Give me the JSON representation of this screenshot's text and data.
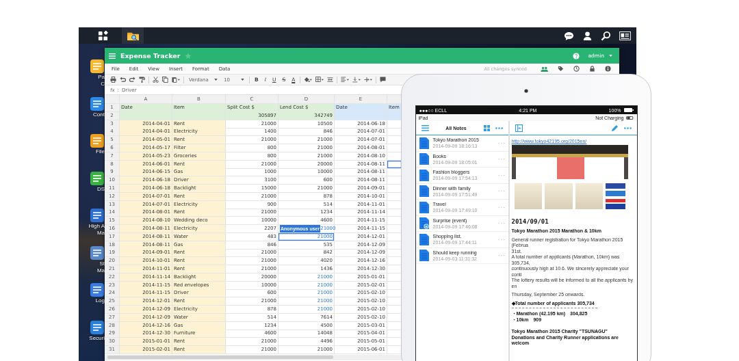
{
  "desktop_icons": [
    {
      "lines": [
        "Pa",
        "C"
      ]
    },
    {
      "lines": [
        "Cont"
      ]
    },
    {
      "lines": [
        "File"
      ]
    },
    {
      "lines": [
        "DS"
      ]
    },
    {
      "lines": [
        "High A",
        "Ma"
      ]
    },
    {
      "lines": [
        "St",
        "Ma"
      ]
    },
    {
      "lines": [
        "Log"
      ]
    },
    {
      "lines": [
        "Securi"
      ]
    }
  ],
  "spreadsheet": {
    "title": "Expense Tracker",
    "starred": false,
    "user": "admin",
    "sync_status": "All changes synced",
    "menu": [
      "File",
      "Edit",
      "View",
      "Insert",
      "Format",
      "Data"
    ],
    "font": "Verdana",
    "font_size": "10",
    "format_buttons": [
      {
        "kind": "bold",
        "label": "B"
      },
      {
        "kind": "italic",
        "label": "I"
      },
      {
        "kind": "underline",
        "label": "U"
      },
      {
        "kind": "strike",
        "label": "S"
      },
      {
        "kind": "color",
        "label": "A"
      }
    ],
    "formula": {
      "label": "fx",
      "separator": ":",
      "value": "Driver"
    },
    "columns": [
      "A",
      "B",
      "C",
      "D",
      "E"
    ],
    "header_row": {
      "n": "1",
      "cells": [
        "Date",
        "Item",
        "Split Cost $",
        "Lend Cost $",
        "Date",
        "Item"
      ]
    },
    "total_row": {
      "n": "2",
      "c": "305897",
      "d": "342749"
    },
    "rows": [
      {
        "n": "3",
        "a": "2014-04-01",
        "b": "Rent",
        "c": "21000",
        "d": "10500",
        "e": "2014-06-18",
        "d_edited": false,
        "d_selected": false,
        "f_selected": false
      },
      {
        "n": "4",
        "a": "2014-04-01",
        "b": "Electricity",
        "c": "1400",
        "d": "846",
        "e": "2014-07-01",
        "d_edited": false,
        "d_selected": false,
        "f_selected": false
      },
      {
        "n": "5",
        "a": "2014-05-01",
        "b": "Rent",
        "c": "21000",
        "d": "21000",
        "e": "2014-07-01",
        "d_edited": false,
        "d_selected": false,
        "f_selected": false
      },
      {
        "n": "6",
        "a": "2014-05-17",
        "b": "Filter",
        "c": "800",
        "d": "21000",
        "e": "2014-08-01",
        "d_edited": false,
        "d_selected": false,
        "f_selected": false
      },
      {
        "n": "7",
        "a": "2014-05-23",
        "b": "Groceries",
        "c": "800",
        "d": "21000",
        "e": "2014-08-10",
        "d_edited": false,
        "d_selected": false,
        "f_selected": false
      },
      {
        "n": "8",
        "a": "2014-06-01",
        "b": "Rent",
        "c": "21000",
        "d": "20000",
        "e": "2014-08-11",
        "d_edited": false,
        "d_selected": false,
        "f_selected": true
      },
      {
        "n": "9",
        "a": "2014-06-15",
        "b": "Gas",
        "c": "1000",
        "d": "10000",
        "e": "2014-08-11",
        "d_edited": false,
        "d_selected": false,
        "f_selected": false
      },
      {
        "n": "10",
        "a": "2014-06-18",
        "b": "Driver",
        "c": "3100",
        "d": "600",
        "e": "2014-08-11",
        "d_edited": false,
        "d_selected": false,
        "f_selected": false
      },
      {
        "n": "11",
        "a": "2014-06-18",
        "b": "Backlight",
        "c": "15000",
        "d": "21000",
        "e": "2014-09-01",
        "d_edited": false,
        "d_selected": false,
        "f_selected": false
      },
      {
        "n": "12",
        "a": "2014-07-01",
        "b": "Rent",
        "c": "21000",
        "d": "878",
        "e": "2014-10-01",
        "d_edited": false,
        "d_selected": false,
        "f_selected": false
      },
      {
        "n": "13",
        "a": "2014-07-01",
        "b": "Electricity",
        "c": "900",
        "d": "514",
        "e": "2014-11-01",
        "d_edited": false,
        "d_selected": false,
        "f_selected": false
      },
      {
        "n": "14",
        "a": "2014-08-01",
        "b": "Rent",
        "c": "21000",
        "d": "1234",
        "e": "2014-11-14",
        "d_edited": false,
        "d_selected": false,
        "f_selected": false
      },
      {
        "n": "15",
        "a": "2014-08-10",
        "b": "Wedding deco",
        "c": "10000",
        "d": "4600",
        "e": "2014-11-15",
        "d_edited": false,
        "d_selected": false,
        "f_selected": false
      },
      {
        "n": "16",
        "a": "2014-08-11",
        "b": "Electricity",
        "c": "2207",
        "d": "21000",
        "e": "2014-11-15",
        "d_edited": true,
        "d_selected": false,
        "f_selected": false,
        "d_user": "Anonymous user"
      },
      {
        "n": "17",
        "a": "2014-08-11",
        "b": "Water",
        "c": "483",
        "d": "21000",
        "e": "2014-12-01",
        "d_edited": true,
        "d_selected": true,
        "f_selected": false
      },
      {
        "n": "18",
        "a": "2014-08-11",
        "b": "Gas",
        "c": "846",
        "d": "535",
        "e": "2014-12-09",
        "d_edited": false,
        "d_selected": false,
        "f_selected": false
      },
      {
        "n": "19",
        "a": "2014-09-01",
        "b": "Rent",
        "c": "21000",
        "d": "842",
        "e": "2014-12-09",
        "d_edited": false,
        "d_selected": false,
        "f_selected": false
      },
      {
        "n": "20",
        "a": "2014-10-01",
        "b": "Rent",
        "c": "21000",
        "d": "4020",
        "e": "2014-12-16",
        "d_edited": false,
        "d_selected": false,
        "f_selected": false
      },
      {
        "n": "21",
        "a": "2014-11-01",
        "b": "Rent",
        "c": "21000",
        "d": "1436",
        "e": "2014-12-30",
        "d_edited": false,
        "d_selected": false,
        "f_selected": false
      },
      {
        "n": "22",
        "a": "2014-11-14",
        "b": "Backlight",
        "c": "20000",
        "d": "21000",
        "e": "2015-01-01",
        "d_edited": true,
        "d_selected": false,
        "f_selected": false
      },
      {
        "n": "23",
        "a": "2014-11-15",
        "b": "Red envelopes",
        "c": "10000",
        "d": "21000",
        "e": "2015-02-01",
        "d_edited": true,
        "d_selected": false,
        "f_selected": false
      },
      {
        "n": "24",
        "a": "2014-11-15",
        "b": "Driver",
        "c": "600",
        "d": "21000",
        "e": "2015-02-10",
        "d_edited": true,
        "d_selected": false,
        "f_selected": false
      },
      {
        "n": "25",
        "a": "2014-12-01",
        "b": "Rent",
        "c": "21000",
        "d": "21000",
        "e": "2015-02-10",
        "d_edited": true,
        "d_selected": false,
        "f_selected": false
      },
      {
        "n": "26",
        "a": "2014-12-09",
        "b": "Electricity",
        "c": "878",
        "d": "21000",
        "e": "2015-02-10",
        "d_edited": true,
        "d_selected": false,
        "f_selected": false
      },
      {
        "n": "27",
        "a": "2014-12-09",
        "b": "Water",
        "c": "514",
        "d": "7614",
        "e": "2015-02-10",
        "d_edited": false,
        "d_selected": false,
        "f_selected": false
      },
      {
        "n": "28",
        "a": "2014-12-16",
        "b": "Gas",
        "c": "1234",
        "d": "4500",
        "e": "2015-03-01",
        "d_edited": false,
        "d_selected": false,
        "f_selected": false
      },
      {
        "n": "29",
        "a": "2014-12-30",
        "b": "Furniture",
        "c": "4600",
        "d": "14048",
        "e": "2015-04-01",
        "d_edited": false,
        "d_selected": false,
        "f_selected": false
      },
      {
        "n": "30",
        "a": "2015-01-01",
        "b": "Rent",
        "c": "21000",
        "d": "4496",
        "e": "2015-05-01",
        "d_edited": false,
        "d_selected": false,
        "f_selected": false
      },
      {
        "n": "31",
        "a": "2015-02-01",
        "b": "Rent",
        "c": "21000",
        "d": "21000",
        "e": "2015-06-01",
        "d_edited": false,
        "d_selected": false,
        "f_selected": false
      }
    ]
  },
  "tablet": {
    "status": {
      "carrier": "●●●○○ ECLL",
      "time": "4:21 PM",
      "battery": "100%",
      "device": "iPad",
      "charging": "Not Charging"
    },
    "list_title": "All Notes",
    "notes": [
      {
        "title": "Tokyo Marathon 2015",
        "date": "2014-09-09 18:16:13",
        "locked": false
      },
      {
        "title": "Books",
        "date": "2014-09-09 18:05:01",
        "locked": false
      },
      {
        "title": "Fashion bloggers",
        "date": "2014-09-09 17:54:13",
        "locked": false
      },
      {
        "title": "Dinner with family",
        "date": "2014-09-09 17:51:49",
        "locked": false
      },
      {
        "title": "Travel",
        "date": "2014-09-09 17:49:10",
        "locked": false
      },
      {
        "title": "Surprise (event)",
        "date": "2014-09-09 17:46:08",
        "locked": true
      },
      {
        "title": "Shopping list.",
        "date": "2014-09-09 17:44:11",
        "locked": false
      },
      {
        "title": "Should keep running",
        "date": "2014-09-03 11:31:32",
        "locked": false
      }
    ],
    "note": {
      "link": "http://www.tokyo42195.org/2015en/",
      "blocks": [
        {
          "kind": "date",
          "lines": [
            "2014/09/01"
          ]
        },
        {
          "kind": "bold",
          "lines": [
            "Tokyo Marathon 2015 Marathon & 10km"
          ]
        },
        {
          "kind": "text",
          "lines": [
            "General runner registration for Tokyo Marathon 2015 (Februa",
            "31st.",
            "A total number of applicants (Marathon, 10km) was 305,734,",
            "continuously high at 10.6. We sincerely appreciate your conti",
            "The lottery results will be informed to all the applicants by en"
          ]
        },
        {
          "kind": "text",
          "lines": [
            "Thursday, September 25 onwards."
          ]
        },
        {
          "kind": "bold",
          "lines": [
            "◆Total number of applicants 305,734"
          ]
        },
        {
          "kind": "rule"
        },
        {
          "kind": "bold",
          "lines": [
            "・Marathon (42.195 km)　304,825",
            "・10km　909"
          ]
        },
        {
          "kind": "bold",
          "lines": [
            "Tokyo Marathon 2015 Charity \"TSUNAGU\"",
            "Donations and Charity Runner applications are welcom"
          ]
        }
      ]
    }
  }
}
